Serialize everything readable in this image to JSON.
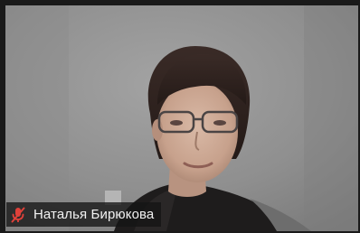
{
  "participant": {
    "name": "Наталья Бирюкова",
    "mic_icon": "mic-muted-icon",
    "mic_state": "muted"
  },
  "colors": {
    "mic_muted": "#e0413a",
    "nameplate_bg": "#141414",
    "name_text": "#f2f2f2"
  }
}
